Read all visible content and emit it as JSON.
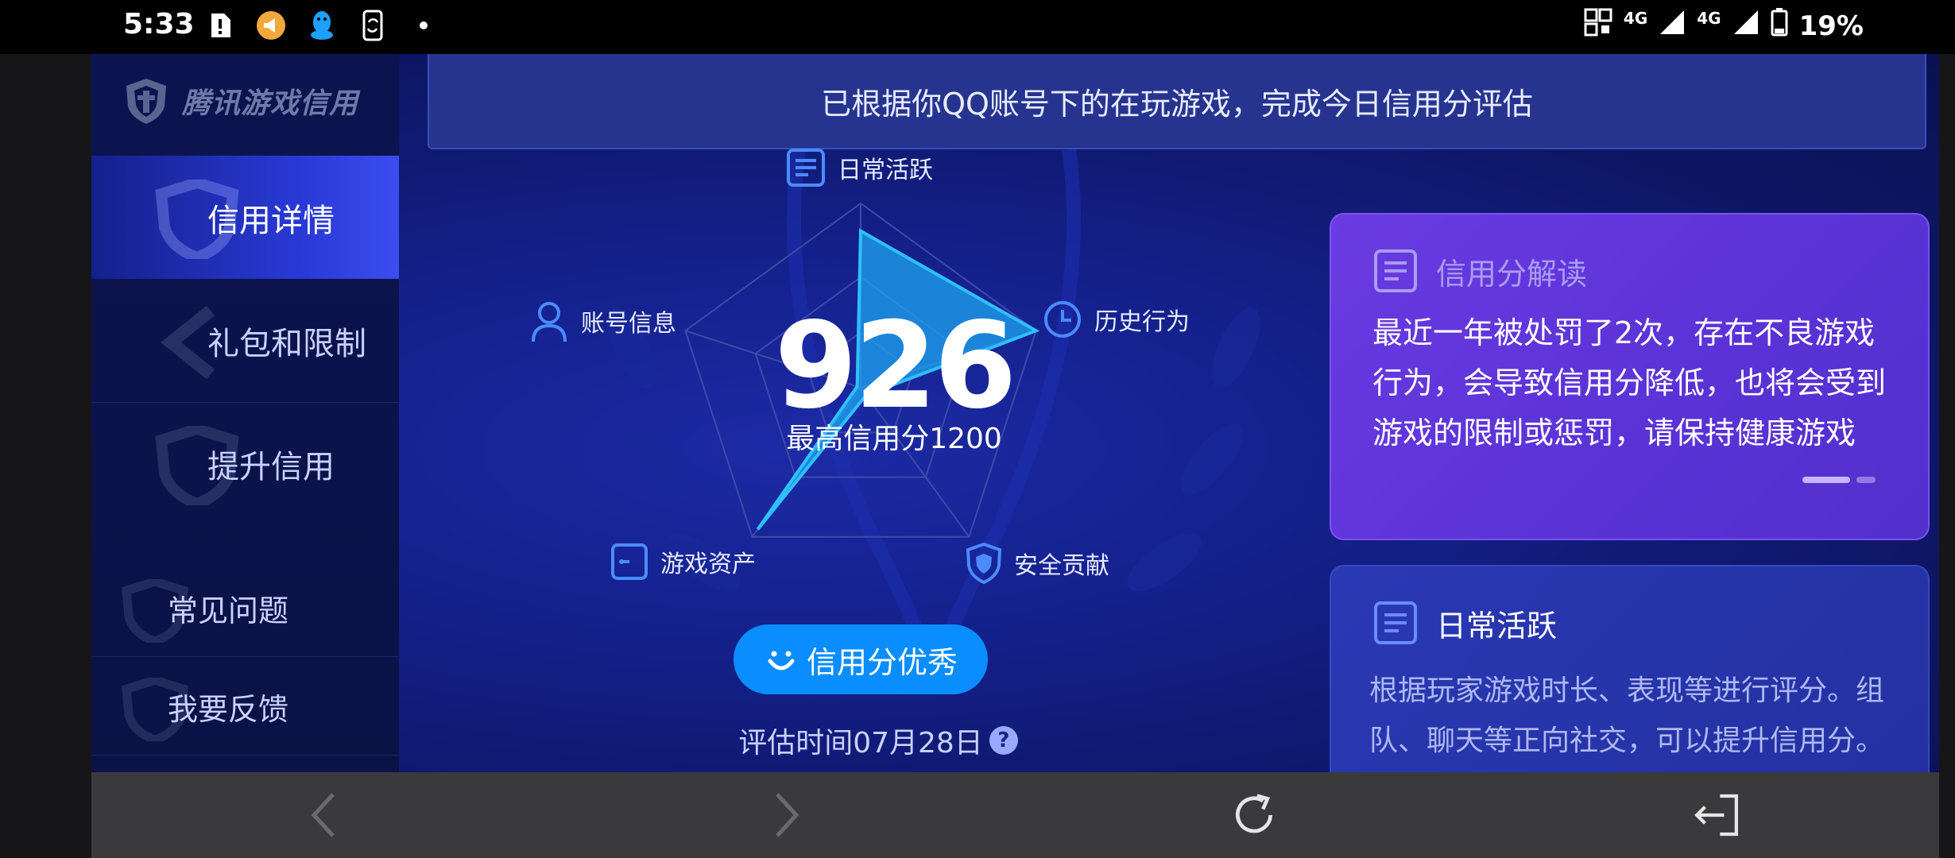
{
  "status_bar": {
    "time": "5:33",
    "network1": "4G",
    "network2": "4G",
    "battery": "19%"
  },
  "brand": {
    "name": "腾讯游戏信用"
  },
  "sidebar": {
    "items": [
      {
        "label": "信用详情",
        "active": true
      },
      {
        "label": "礼包和限制",
        "active": false
      },
      {
        "label": "提升信用",
        "active": false
      }
    ],
    "footer_items": [
      {
        "label": "常见问题"
      },
      {
        "label": "我要反馈"
      }
    ]
  },
  "banner": {
    "text": "已根据你QQ账号下的在玩游戏，完成今日信用分评估"
  },
  "radar": {
    "score": "926",
    "max_label": "最高信用分1200",
    "dimensions": [
      {
        "label": "日常活跃",
        "icon": "document-icon",
        "value": 0.85
      },
      {
        "label": "历史行为",
        "icon": "clock-icon",
        "value": 1.0
      },
      {
        "label": "安全贡献",
        "icon": "shield-icon",
        "value": 0.05
      },
      {
        "label": "游戏资产",
        "icon": "card-icon",
        "value": 0.95
      },
      {
        "label": "账号信息",
        "icon": "user-icon",
        "value": 0.02
      }
    ]
  },
  "rating_badge": {
    "label": "信用分优秀",
    "icon": "smile-icon"
  },
  "eval_time": {
    "label": "评估时间07月28日",
    "help": "?"
  },
  "card_interpretation": {
    "title": "信用分解读",
    "body": "最近一年被处罚了2次，存在不良游戏行为，会导致信用分降低，也将会受到游戏的限制或惩罚，请保持健康游戏"
  },
  "card_daily": {
    "title": "日常活跃",
    "body": "根据玩家游戏时长、表现等进行评分。组队、聊天等正向社交，可以提升信用分。恶"
  },
  "colors": {
    "accent": "#0a8dff",
    "card_purple": "#5a32d6",
    "radar_fill": "#1ea6f0"
  }
}
